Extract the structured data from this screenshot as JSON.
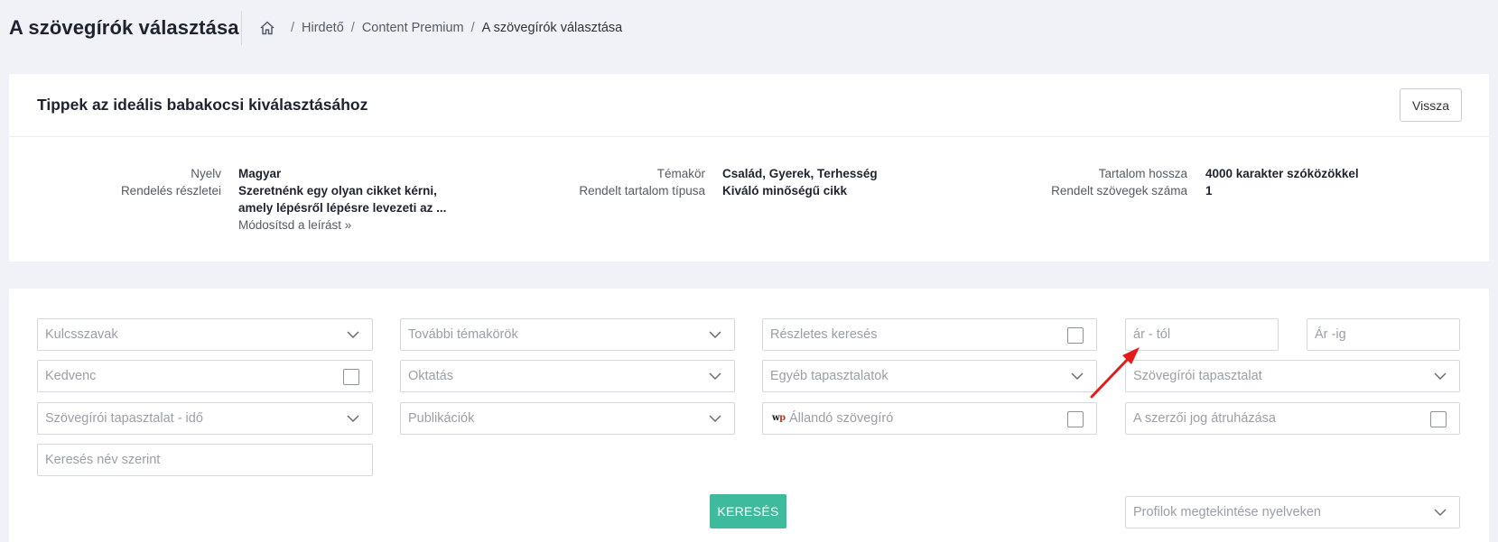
{
  "page": {
    "title": "A szövegírók választása",
    "breadcrumb": [
      "Hirdető",
      "Content Premium",
      "A szövegírók választása"
    ]
  },
  "order_card": {
    "title": "Tippek az ideális babakocsi kiválasztásához",
    "back_label": "Vissza",
    "fields": {
      "language_label": "Nyelv",
      "language_value": "Magyar",
      "details_label": "Rendelés részletei",
      "details_value": "Szeretnénk egy olyan cikket kérni, amely lépésről lépésre levezeti az ...",
      "modify_link": "Módosítsd a leírást »",
      "topic_label": "Témakör",
      "topic_value": "Család, Gyerek, Terhesség",
      "content_type_label": "Rendelt tartalom típusa",
      "content_type_value": "Kiváló minőségű cikk",
      "length_label": "Tartalom hossza",
      "length_value": "4000 karakter szóközökkel",
      "count_label": "Rendelt szövegek száma",
      "count_value": "1"
    }
  },
  "search_card": {
    "keywords": "Kulcsszavak",
    "more_topics": "További témakörök",
    "detailed_search": "Részletes keresés",
    "price_from": "ár - tól",
    "price_to": "Ár -ig",
    "favorite": "Kedvenc",
    "education": "Oktatás",
    "other_experience": "Egyéb tapasztalatok",
    "writer_experience": "Szövegírói tapasztalat",
    "writer_experience_time": "Szövegírói tapasztalat - idő",
    "publications": "Publikációk",
    "permanent_writer": "Állandó szövegíró",
    "copyright_transfer": "A szerzői jog átruházása",
    "search_by_name": "Keresés név szerint",
    "search_button": "KERESÉS",
    "profile_languages": "Profilok megtekintése nyelveken"
  },
  "colors": {
    "accent": "#3dbb9c",
    "background": "#f0f2f7",
    "annotation_arrow": "#e31b1b"
  }
}
